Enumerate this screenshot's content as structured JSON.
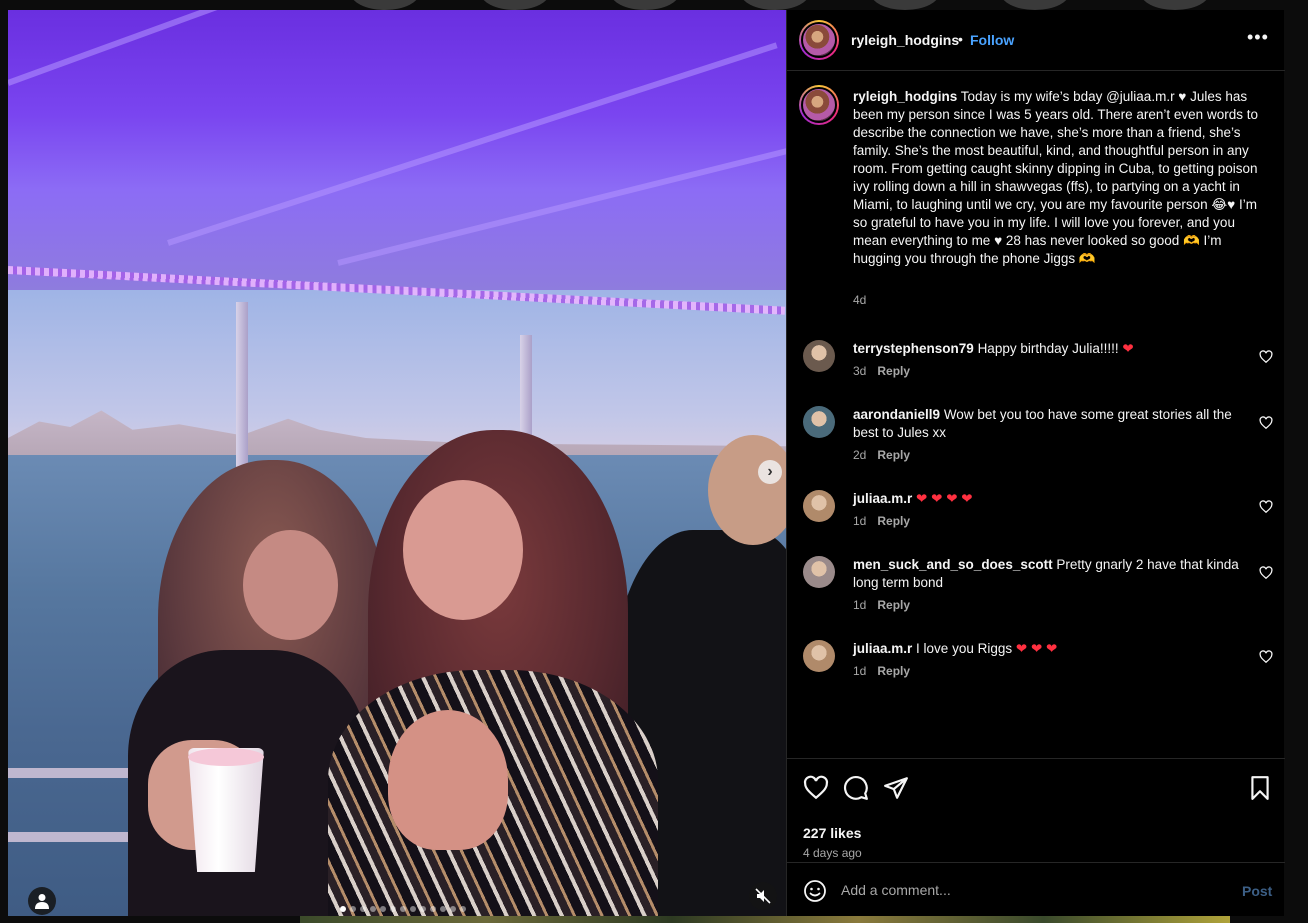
{
  "header": {
    "username": "ryleigh_hodgins",
    "dot": "•",
    "follow_label": "Follow",
    "more_label": "•••"
  },
  "caption": {
    "username": "ryleigh_hodgins",
    "text": "Today is my wife’s bday @juliaa.m.r ♥ Jules has been my person since I was 5 years old. There aren’t even words to describe the connection we have, she’s more than a friend, she’s family. She’s the most beautiful, kind, and thoughtful person in any room. From getting caught skinny dipping in Cuba, to getting poison ivy rolling down a hill in shawvegas (ffs), to partying on a yacht in Miami, to laughing until we cry, you are my favourite person 😂♥ I’m so grateful to have you in my life. I will love you forever, and you mean everything to me ♥ 28 has never looked so good 🫶 I’m hugging you through the phone Jiggs 🫶",
    "time": "4d"
  },
  "comments": [
    {
      "username": "terrystephenson79",
      "text": "Happy birthday Julia!!!!! ❤",
      "time": "3d",
      "reply": "Reply",
      "avatar_color": "#6b5a4e"
    },
    {
      "username": "aarondaniell9",
      "text": "Wow bet you too have some great stories all the best to Jules xx",
      "time": "2d",
      "reply": "Reply",
      "avatar_color": "#4a6a7a"
    },
    {
      "username": "juliaa.m.r",
      "text": "❤ ❤ ❤ ❤",
      "time": "1d",
      "reply": "Reply",
      "avatar_color": "#b08a6a"
    },
    {
      "username": "men_suck_and_so_does_scott",
      "text": "Pretty gnarly 2 have that kinda long term bond",
      "time": "1d",
      "reply": "Reply",
      "avatar_color": "#9a8a8a"
    },
    {
      "username": "juliaa.m.r",
      "text": "I love you Riggs ❤ ❤ ❤",
      "time": "1d",
      "reply": "Reply",
      "avatar_color": "#b08a6a"
    }
  ],
  "actions": {
    "like_icon": "heart-icon",
    "comment_icon": "comment-icon",
    "share_icon": "send-icon",
    "save_icon": "bookmark-icon"
  },
  "likes": "227 likes",
  "posted": "4 days ago",
  "add_comment": {
    "placeholder": "Add a comment...",
    "post_label": "Post"
  },
  "media": {
    "next_label": "›",
    "slide_count": 13,
    "active_slide": 1
  },
  "colors": {
    "link": "#4aa3ff",
    "heart": "#ff3040",
    "muted": "#a8a8a8",
    "post_disabled": "#3c5f86"
  }
}
